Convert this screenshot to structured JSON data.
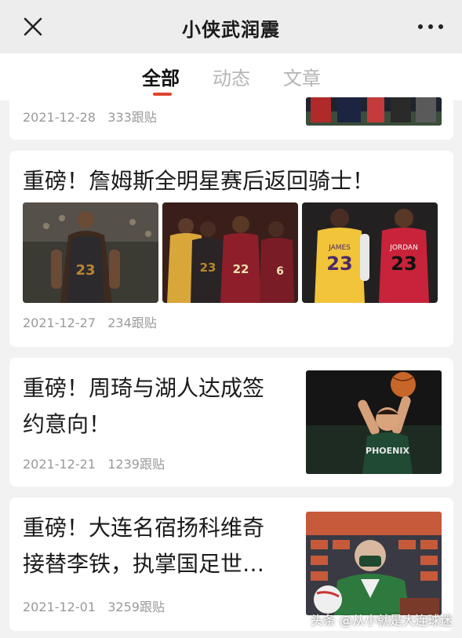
{
  "header": {
    "title": "小侠武润震",
    "close_icon": "close-icon",
    "more_icon": "more-dots-icon"
  },
  "tabs": [
    {
      "label": "全部",
      "active": true
    },
    {
      "label": "动态",
      "active": false
    },
    {
      "label": "文章",
      "active": false
    }
  ],
  "accent_color": "#e0442e",
  "feed": [
    {
      "date": "2021-12-28",
      "replies": "333跟贴"
    },
    {
      "headline": "重磅！詹姆斯全明星赛后返回骑士！",
      "date": "2021-12-27",
      "replies": "234跟贴",
      "image_jerseys": [
        "23",
        "23",
        "22",
        "6",
        "JAMES 23",
        "JORDAN 23"
      ]
    },
    {
      "headline_line1": "重磅！周琦与湖人达成签",
      "headline_line2": "约意向！",
      "date": "2021-12-21",
      "replies": "1239跟贴",
      "image_text": "PHOENIX"
    },
    {
      "headline_line1": "重磅！大连名宿扬科维奇",
      "headline_line2": "接替李铁，执掌国足世…",
      "date": "2021-12-01",
      "replies": "3259跟贴"
    }
  ],
  "watermark": "头条 @从小就是大连球迷"
}
